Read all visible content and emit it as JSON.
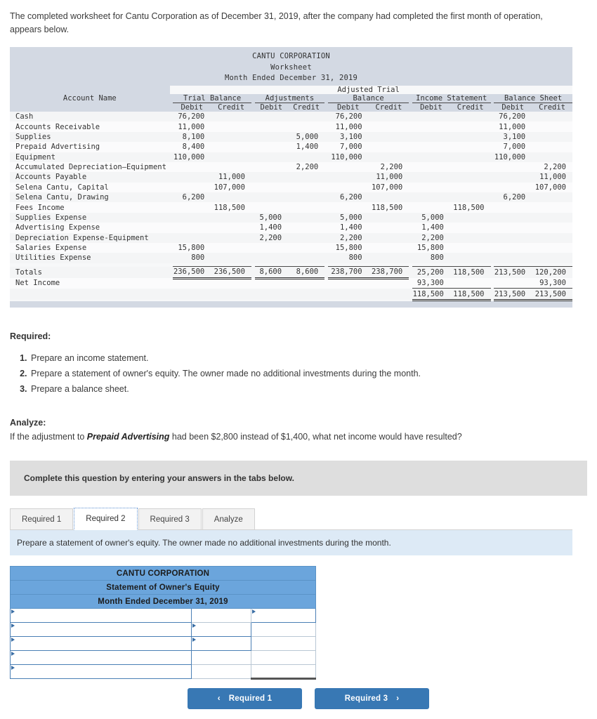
{
  "intro": {
    "text": "The completed worksheet for Cantu Corporation as of December 31, 2019, after the company had completed the first month of operation, appears below."
  },
  "worksheet": {
    "company": "CANTU CORPORATION",
    "doc_type": "Worksheet",
    "period": "Month Ended December 31, 2019",
    "account_header": "Account Name",
    "group_headers": [
      "Trial Balance",
      "Adjustments",
      "Adjusted Trial",
      "Balance",
      "Income Statement",
      "Balance Sheet"
    ],
    "adjusted_line1": "Adjusted Trial",
    "adjusted_line2": "Balance",
    "sub_headers": {
      "debit": "Debit",
      "credit": "Credit"
    },
    "rows": [
      {
        "account": "Cash",
        "tb_dr": "76,200",
        "tb_cr": "",
        "adj_dr": "",
        "adj_cr": "",
        "atb_dr": "76,200",
        "atb_cr": "",
        "is_dr": "",
        "is_cr": "",
        "bs_dr": "76,200",
        "bs_cr": ""
      },
      {
        "account": "Accounts Receivable",
        "tb_dr": "11,000",
        "tb_cr": "",
        "adj_dr": "",
        "adj_cr": "",
        "atb_dr": "11,000",
        "atb_cr": "",
        "is_dr": "",
        "is_cr": "",
        "bs_dr": "11,000",
        "bs_cr": ""
      },
      {
        "account": "Supplies",
        "tb_dr": "8,100",
        "tb_cr": "",
        "adj_dr": "",
        "adj_cr": "5,000",
        "atb_dr": "3,100",
        "atb_cr": "",
        "is_dr": "",
        "is_cr": "",
        "bs_dr": "3,100",
        "bs_cr": ""
      },
      {
        "account": "Prepaid Advertising",
        "tb_dr": "8,400",
        "tb_cr": "",
        "adj_dr": "",
        "adj_cr": "1,400",
        "atb_dr": "7,000",
        "atb_cr": "",
        "is_dr": "",
        "is_cr": "",
        "bs_dr": "7,000",
        "bs_cr": ""
      },
      {
        "account": "Equipment",
        "tb_dr": "110,000",
        "tb_cr": "",
        "adj_dr": "",
        "adj_cr": "",
        "atb_dr": "110,000",
        "atb_cr": "",
        "is_dr": "",
        "is_cr": "",
        "bs_dr": "110,000",
        "bs_cr": ""
      },
      {
        "account": "Accumulated Depreciation—Equipment",
        "tb_dr": "",
        "tb_cr": "",
        "adj_dr": "",
        "adj_cr": "2,200",
        "atb_dr": "",
        "atb_cr": "2,200",
        "is_dr": "",
        "is_cr": "",
        "bs_dr": "",
        "bs_cr": "2,200"
      },
      {
        "account": "Accounts Payable",
        "tb_dr": "",
        "tb_cr": "11,000",
        "adj_dr": "",
        "adj_cr": "",
        "atb_dr": "",
        "atb_cr": "11,000",
        "is_dr": "",
        "is_cr": "",
        "bs_dr": "",
        "bs_cr": "11,000"
      },
      {
        "account": "Selena Cantu, Capital",
        "tb_dr": "",
        "tb_cr": "107,000",
        "adj_dr": "",
        "adj_cr": "",
        "atb_dr": "",
        "atb_cr": "107,000",
        "is_dr": "",
        "is_cr": "",
        "bs_dr": "",
        "bs_cr": "107,000"
      },
      {
        "account": "Selena Cantu, Drawing",
        "tb_dr": "6,200",
        "tb_cr": "",
        "adj_dr": "",
        "adj_cr": "",
        "atb_dr": "6,200",
        "atb_cr": "",
        "is_dr": "",
        "is_cr": "",
        "bs_dr": "6,200",
        "bs_cr": ""
      },
      {
        "account": "Fees Income",
        "tb_dr": "",
        "tb_cr": "118,500",
        "adj_dr": "",
        "adj_cr": "",
        "atb_dr": "",
        "atb_cr": "118,500",
        "is_dr": "",
        "is_cr": "118,500",
        "bs_dr": "",
        "bs_cr": ""
      },
      {
        "account": "Supplies Expense",
        "tb_dr": "",
        "tb_cr": "",
        "adj_dr": "5,000",
        "adj_cr": "",
        "atb_dr": "5,000",
        "atb_cr": "",
        "is_dr": "5,000",
        "is_cr": "",
        "bs_dr": "",
        "bs_cr": ""
      },
      {
        "account": "Advertising Expense",
        "tb_dr": "",
        "tb_cr": "",
        "adj_dr": "1,400",
        "adj_cr": "",
        "atb_dr": "1,400",
        "atb_cr": "",
        "is_dr": "1,400",
        "is_cr": "",
        "bs_dr": "",
        "bs_cr": ""
      },
      {
        "account": "Depreciation Expense-Equipment",
        "tb_dr": "",
        "tb_cr": "",
        "adj_dr": "2,200",
        "adj_cr": "",
        "atb_dr": "2,200",
        "atb_cr": "",
        "is_dr": "2,200",
        "is_cr": "",
        "bs_dr": "",
        "bs_cr": ""
      },
      {
        "account": "Salaries Expense",
        "tb_dr": "15,800",
        "tb_cr": "",
        "adj_dr": "",
        "adj_cr": "",
        "atb_dr": "15,800",
        "atb_cr": "",
        "is_dr": "15,800",
        "is_cr": "",
        "bs_dr": "",
        "bs_cr": ""
      },
      {
        "account": "Utilities Expense",
        "tb_dr": "800",
        "tb_cr": "",
        "adj_dr": "",
        "adj_cr": "",
        "atb_dr": "800",
        "atb_cr": "",
        "is_dr": "800",
        "is_cr": "",
        "bs_dr": "",
        "bs_cr": ""
      }
    ],
    "totals": {
      "label": "Totals",
      "tb_dr": "236,500",
      "tb_cr": "236,500",
      "adj_dr": "8,600",
      "adj_cr": "8,600",
      "atb_dr": "238,700",
      "atb_cr": "238,700",
      "is_dr": "25,200",
      "is_cr": "118,500",
      "bs_dr": "213,500",
      "bs_cr": "120,200"
    },
    "net_income": {
      "label": "Net Income",
      "is_dr": "93,300",
      "is_cr": "",
      "bs_dr": "",
      "bs_cr": "93,300"
    },
    "grand_totals": {
      "label": "",
      "is_dr": "118,500",
      "is_cr": "118,500",
      "bs_dr": "213,500",
      "bs_cr": "213,500"
    }
  },
  "required": {
    "title": "Required:",
    "items": [
      "Prepare an income statement.",
      "Prepare a statement of owner's equity. The owner made no additional investments during the month.",
      "Prepare a balance sheet."
    ]
  },
  "analyze": {
    "title": "Analyze:",
    "prefix": "If the adjustment to ",
    "emphasis": "Prepaid Advertising",
    "suffix": " had been $2,800 instead of $1,400, what net income would have resulted?"
  },
  "callout": {
    "text": "Complete this question by entering your answers in the tabs below."
  },
  "tabs": {
    "items": [
      {
        "label": "Required 1",
        "active": false
      },
      {
        "label": "Required 2",
        "active": true
      },
      {
        "label": "Required 3",
        "active": false
      },
      {
        "label": "Analyze",
        "active": false
      }
    ],
    "instruction": "Prepare a statement of owner's equity. The owner made no additional investments during the month."
  },
  "answer_form": {
    "title_lines": [
      "CANTU CORPORATION",
      "Statement of Owner's Equity",
      "Month Ended December 31, 2019"
    ],
    "rows": [
      {
        "desc": "",
        "mid": "",
        "right": ""
      },
      {
        "desc": "",
        "mid": "",
        "right": ""
      },
      {
        "desc": "",
        "mid": "",
        "right": ""
      },
      {
        "desc": "",
        "mid": "",
        "right": ""
      },
      {
        "desc": "",
        "mid": "",
        "right": ""
      }
    ]
  },
  "nav": {
    "prev_label": "Required 1",
    "next_label": "Required 3",
    "prev_icon": "chevron-left",
    "next_icon": "chevron-right"
  },
  "colors": {
    "header_bg": "#d3d9e3",
    "accent_blue": "#6ba5dc",
    "button_blue": "#3878b4",
    "strip_blue": "#ddeaf6",
    "callout_gray": "#dedede"
  }
}
